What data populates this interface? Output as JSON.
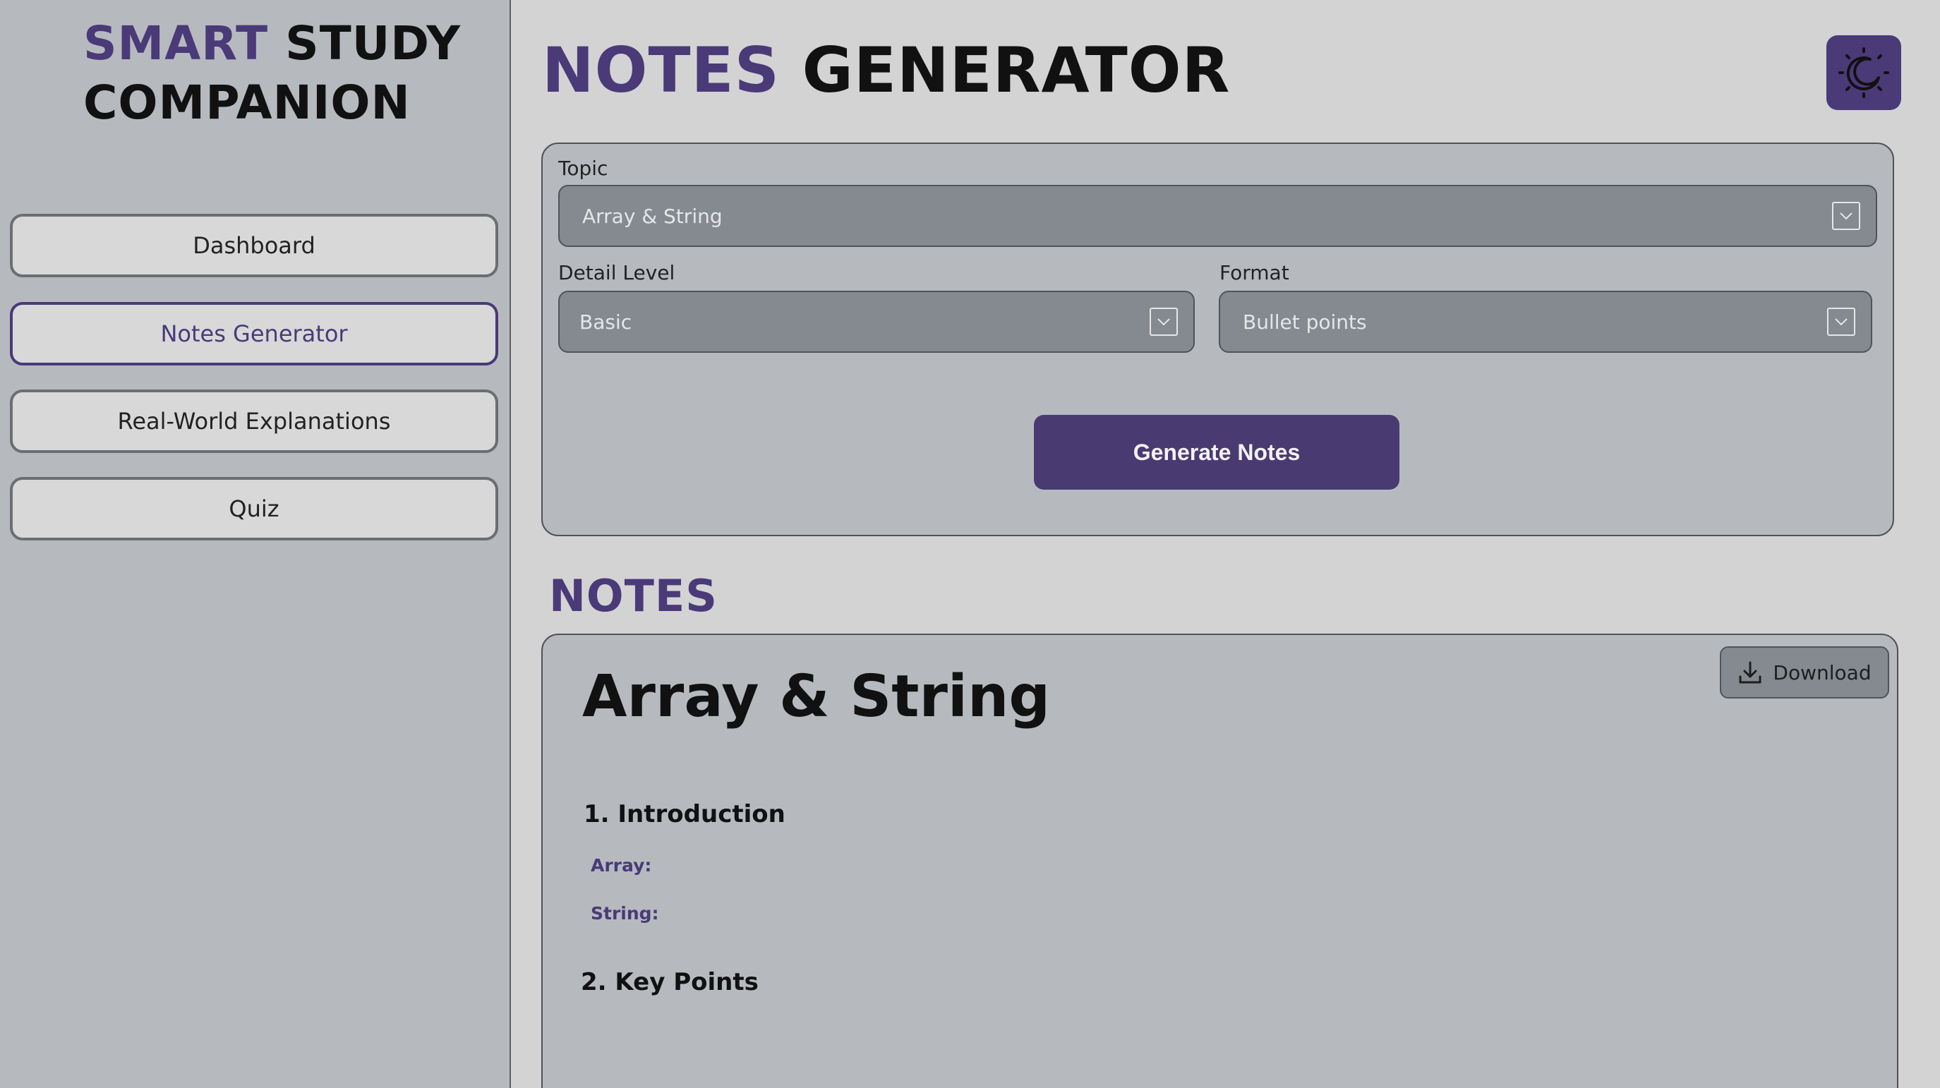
{
  "sidebar": {
    "brand_accent": "SMART",
    "brand_rest_line1": "STUDY",
    "brand_line2": "COMPANION",
    "items": [
      {
        "label": "Dashboard"
      },
      {
        "label": "Notes Generator"
      },
      {
        "label": "Real-World Explanations"
      },
      {
        "label": "Quiz"
      }
    ],
    "active_item": "Notes Generator"
  },
  "header": {
    "title_accent": "NOTES",
    "title_rest": "GENERATOR",
    "theme_toggle_icon": "moon-sun-icon"
  },
  "form": {
    "topic_label": "Topic",
    "topic_value": "Array & String",
    "detail_label": "Detail Level",
    "detail_value": "Basic",
    "format_label": "Format",
    "format_value": "Bullet points",
    "generate_label": "Generate Notes"
  },
  "notes": {
    "heading": "NOTES",
    "download_label": "Download",
    "doc_title": "Array & String",
    "sections": [
      {
        "title": "1. Introduction",
        "items": [
          "Array:",
          "String:"
        ]
      },
      {
        "title": "2. Key Points",
        "items": []
      }
    ]
  },
  "colors": {
    "accent": "#4a3a78",
    "sidebar_bg": "#b6babf",
    "page_bg": "#d3d3d4",
    "select_bg": "#858990"
  }
}
